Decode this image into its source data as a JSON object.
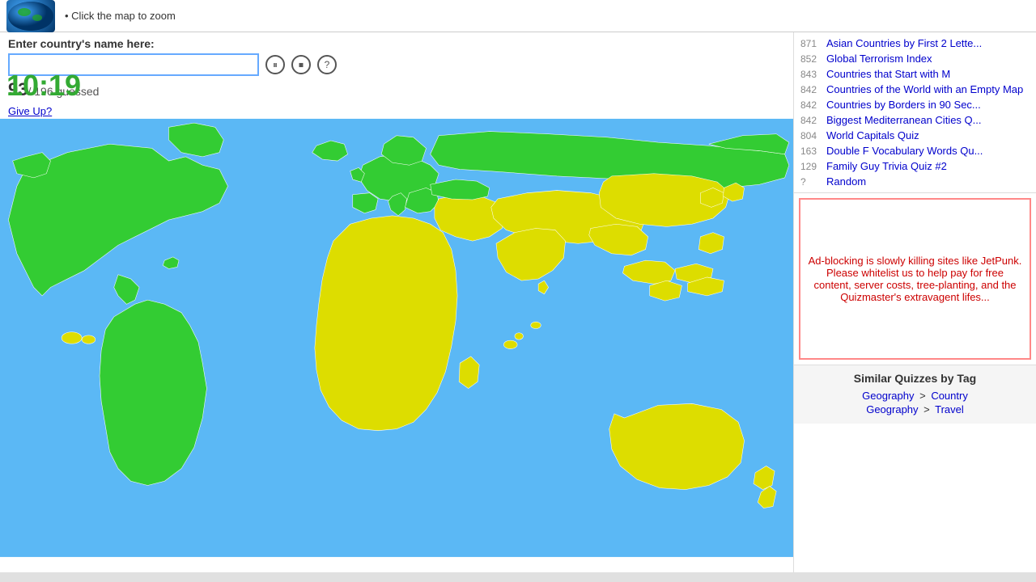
{
  "header": {
    "click_hint": "• Click the map to zoom"
  },
  "quiz": {
    "label": "Enter country's name here:",
    "input_value": "",
    "input_placeholder": "",
    "score": "93",
    "total": "196",
    "score_text": "/ 196 guessed",
    "timer": "10:19",
    "give_up": "Give Up?"
  },
  "controls": {
    "pause": "⏸",
    "stop": "⏹",
    "help": "?"
  },
  "related_quizzes": [
    {
      "num": "871",
      "text": "Asian Countries by First 2 Lette..."
    },
    {
      "num": "852",
      "text": "Global Terrorism Index"
    },
    {
      "num": "843",
      "text": "Countries that Start with M"
    },
    {
      "num": "842",
      "text": "Countries of the World with an Empty Map"
    },
    {
      "num": "842",
      "text": "Countries by Borders in 90 Sec..."
    },
    {
      "num": "842",
      "text": "Biggest Mediterranean Cities Q..."
    },
    {
      "num": "804",
      "text": "World Capitals Quiz"
    },
    {
      "num": "163",
      "text": "Double F Vocabulary Words Qu..."
    },
    {
      "num": "129",
      "text": "Family Guy Trivia Quiz #2"
    },
    {
      "num": "?",
      "text": "Random"
    }
  ],
  "ad_box": {
    "message": "Ad-blocking is slowly killing sites like JetPunk. Please whitelist us to help pay for free content, server costs, tree-planting, and the Quizmaster's extravagent lifes..."
  },
  "similar_quizzes": {
    "title": "Similar Quizzes by Tag",
    "rows": [
      {
        "tag1": "Geography",
        "sep1": ">",
        "tag2": "Country"
      },
      {
        "tag1": "Geography",
        "sep2": ">",
        "tag2": "Travel"
      }
    ]
  }
}
